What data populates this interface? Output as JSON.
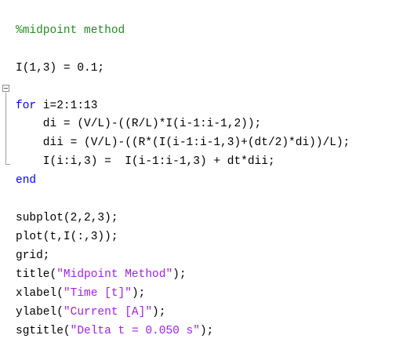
{
  "editor": {
    "lines": [
      {
        "text": "%midpoint method",
        "style": "comment"
      },
      {
        "text": "I(1,3) = 0.1;",
        "style": "plain"
      },
      {
        "keyword": "for",
        "rest": " i=2:1:13"
      },
      {
        "text": "    di = (V/L)-((R/L)*I(i-1:i-1,2));",
        "style": "plain"
      },
      {
        "text": "    dii = (V/L)-((R*(I(i-1:i-1,3)+(dt/2)*di))/L);",
        "style": "plain"
      },
      {
        "text": "    I(i:i,3) =  I(i-1:i-1,3) + dt*dii;",
        "style": "plain"
      },
      {
        "keyword": "end"
      },
      {
        "text": "subplot(2,2,3);",
        "style": "plain"
      },
      {
        "text": "plot(t,I(:,3));",
        "style": "plain"
      },
      {
        "text": "grid;",
        "style": "plain"
      },
      {
        "pre": "title(",
        "str": "\"Midpoint Method\"",
        "post": ");"
      },
      {
        "pre": "xlabel(",
        "str": "\"Time [t]\"",
        "post": ");"
      },
      {
        "pre": "ylabel(",
        "str": "\"Current [A]\"",
        "post": ");"
      },
      {
        "pre": "sgtitle(",
        "str": "\"Delta t = 0.050 s\"",
        "post": ");"
      }
    ]
  },
  "colors": {
    "comment": "#228B22",
    "keyword": "#0000FF",
    "string": "#A020F0",
    "text": "#000000",
    "background": "#FFFFFF"
  },
  "icons": {
    "fold": "fold-collapse-icon"
  }
}
